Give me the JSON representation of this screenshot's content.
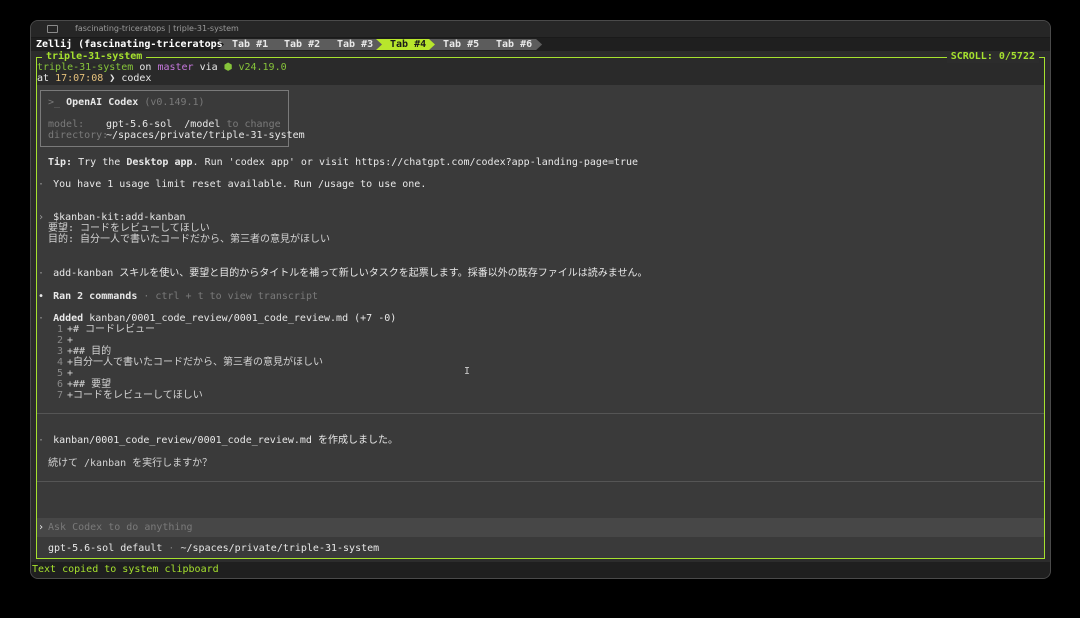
{
  "window": {
    "title": "fascinating-triceratops | triple-31-system"
  },
  "tabbar": {
    "session": "Zellij (fascinating-triceratops)",
    "tabs": [
      "Tab #1",
      "Tab #2",
      "Tab #3",
      "Tab #4",
      "Tab #5",
      "Tab #6"
    ],
    "active_tab": "Tab #4"
  },
  "pane": {
    "title": "triple-31-system",
    "scroll": "SCROLL:  0/5722"
  },
  "prompt": {
    "dir": "triple-31-system",
    "on": "on",
    "branch_icon": "",
    "branch": "master",
    "via": "via",
    "node_icon": "⬢",
    "node_version": "v24.19.0",
    "at": "at",
    "time": "17:07:08",
    "arrow": "❯",
    "command": "codex"
  },
  "codex_box": {
    "header_prefix": ">_",
    "name": "OpenAI Codex",
    "version": "(v0.149.1)",
    "model_label": "model:",
    "model_value": "gpt-5.6-sol",
    "model_cmd": "/model",
    "model_hint": "to change",
    "dir_label": "directory:",
    "dir_value": "~/spaces/private/triple-31-system"
  },
  "tip": {
    "label": "Tip:",
    "text_a": "Try the",
    "bold": "Desktop app",
    "text_b": ". Run 'codex app' or visit https://chatgpt.com/codex?app-landing-page=true"
  },
  "usage": "You have 1 usage limit reset available. Run /usage to use one.",
  "user_message": {
    "line1": "$kanban-kit:add-kanban",
    "line2": "要望: コードをレビューしてほしい",
    "line3": "目的: 自分一人で書いたコードだから、第三者の意見がほしい"
  },
  "assistant_note": "add-kanban スキルを使い、要望と目的からタイトルを補って新しいタスクを起票します。採番以外の既存ファイルは読みません。",
  "ran": {
    "label": "Ran 2 commands",
    "hint": "· ctrl + t to view transcript"
  },
  "added": {
    "label": "Added",
    "path": "kanban/0001_code_review/0001_code_review.md",
    "stats": "(+7 -0)",
    "lines": [
      {
        "n": "1",
        "text": "+# コードレビュー"
      },
      {
        "n": "2",
        "text": "+"
      },
      {
        "n": "3",
        "text": "+## 目的"
      },
      {
        "n": "4",
        "text": "+自分一人で書いたコードだから、第三者の意見がほしい"
      },
      {
        "n": "5",
        "text": "+"
      },
      {
        "n": "6",
        "text": "+## 要望"
      },
      {
        "n": "7",
        "text": "+コードをレビューしてほしい"
      }
    ]
  },
  "result": {
    "created": "kanban/0001_code_review/0001_code_review.md を作成しました。",
    "question": "続けて /kanban を実行しますか？"
  },
  "input": {
    "placeholder": "Ask Codex to do anything"
  },
  "status": {
    "model": "gpt-5.6-sol default",
    "path": "~/spaces/private/triple-31-system"
  },
  "bottom_message": "Text copied to system clipboard",
  "colors": {
    "accent_green": "#a6e22e",
    "active_tab": "#b8e62c",
    "background": "#2c2c2c"
  }
}
